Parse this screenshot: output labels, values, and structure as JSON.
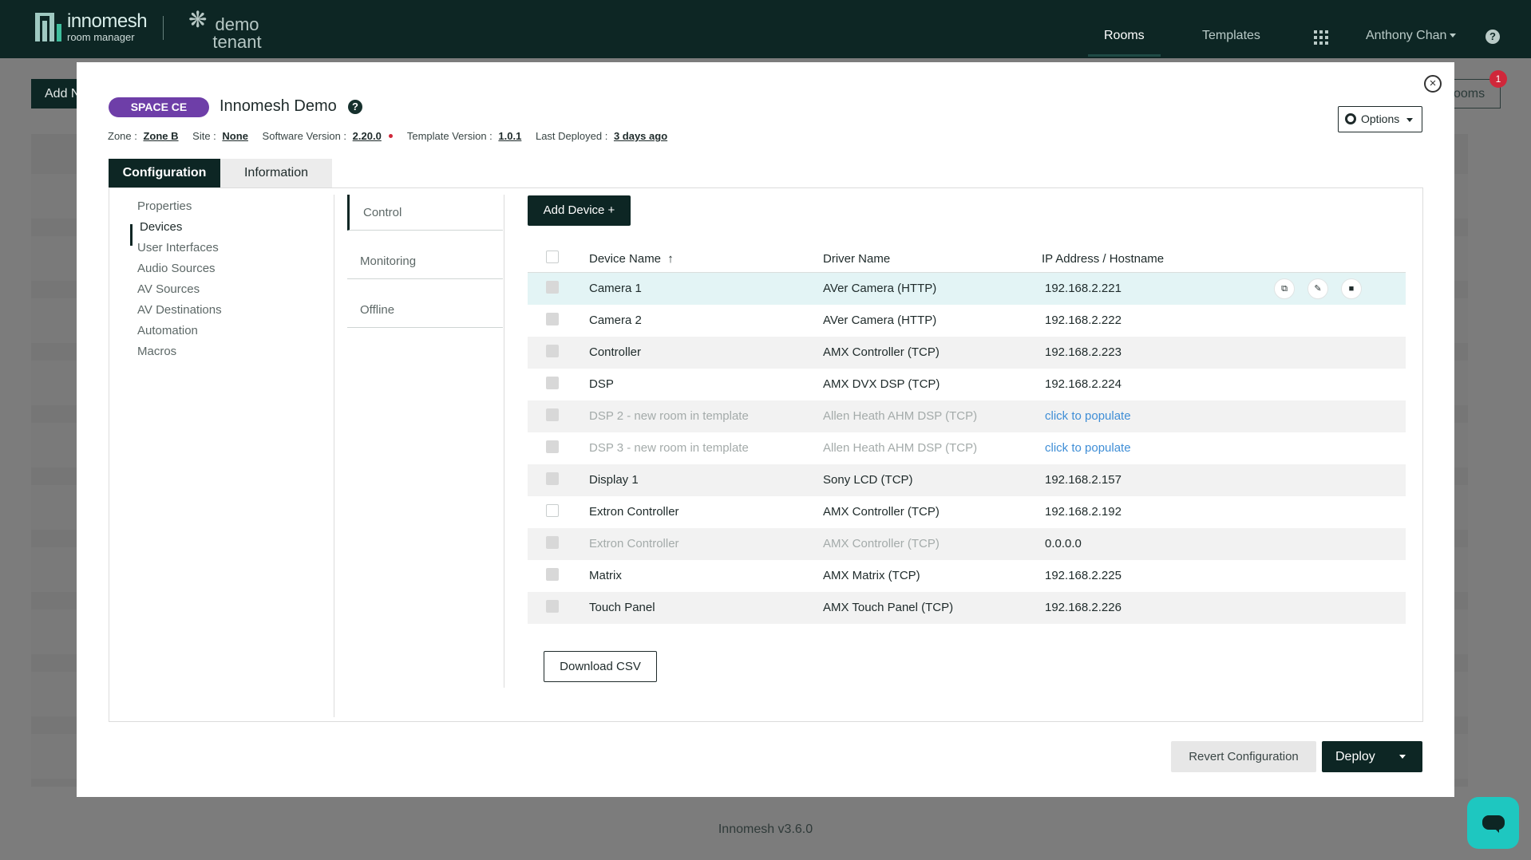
{
  "nav": {
    "brand": "innomesh",
    "brand_sub": "room manager",
    "tenant": "demo tenant",
    "links": {
      "rooms": "Rooms",
      "templates": "Templates"
    },
    "user": "Anthony Chan",
    "help": "?"
  },
  "background": {
    "add_button": "Add N",
    "rooms_button": "ooms",
    "notification_count": "1",
    "footer": "Innomesh v3.6.0"
  },
  "modal": {
    "close": "×",
    "badge": "SPACE CE",
    "title": "Innomesh Demo",
    "title_help": "?",
    "meta": {
      "zone_label": "Zone :",
      "zone": "Zone B",
      "site_label": "Site :",
      "site": "None",
      "software_label": "Software Version :",
      "software": "2.20.0",
      "template_label": "Template Version :",
      "template": "1.0.1",
      "deployed_label": "Last Deployed :",
      "deployed": "3 days ago"
    },
    "options": "Options",
    "tabs": {
      "configuration": "Configuration",
      "information": "Information"
    },
    "sidebar": [
      "Properties",
      "Devices",
      "User Interfaces",
      "Audio Sources",
      "AV Sources",
      "AV Destinations",
      "Automation",
      "Macros"
    ],
    "subnav": [
      "Control",
      "Monitoring",
      "Offline"
    ],
    "add_device": "Add Device +",
    "table": {
      "headers": {
        "name": "Device Name",
        "driver": "Driver Name",
        "ip": "IP Address / Hostname"
      },
      "sort_icon": "↑",
      "rows": [
        {
          "name": "Camera 1",
          "driver": "AVer Camera (HTTP)",
          "ip": "192.168.2.221"
        },
        {
          "name": "Camera 2",
          "driver": "AVer Camera (HTTP)",
          "ip": "192.168.2.222"
        },
        {
          "name": "Controller",
          "driver": "AMX Controller (TCP)",
          "ip": "192.168.2.223"
        },
        {
          "name": "DSP",
          "driver": "AMX DVX DSP (TCP)",
          "ip": "192.168.2.224"
        },
        {
          "name": "DSP 2 - new room in template",
          "driver": "Allen Heath AHM DSP (TCP)",
          "ip": "click to populate"
        },
        {
          "name": "DSP 3 - new room in template",
          "driver": "Allen Heath AHM DSP (TCP)",
          "ip": "click to populate"
        },
        {
          "name": "Display 1",
          "driver": "Sony LCD (TCP)",
          "ip": "192.168.2.157"
        },
        {
          "name": "Extron Controller",
          "driver": "AMX Controller (TCP)",
          "ip": "192.168.2.192"
        },
        {
          "name": "Extron Controller",
          "driver": "AMX Controller (TCP)",
          "ip": "0.0.0.0"
        },
        {
          "name": "Matrix",
          "driver": "AMX Matrix (TCP)",
          "ip": "192.168.2.225"
        },
        {
          "name": "Touch Panel",
          "driver": "AMX Touch Panel (TCP)",
          "ip": "192.168.2.226"
        }
      ]
    },
    "download_csv": "Download CSV",
    "revert": "Revert Configuration",
    "deploy": "Deploy"
  },
  "colors": {
    "brand_dark": "#0d2624",
    "accent_teal": "#3fbf9d",
    "badge_purple": "#6e3ea8",
    "link_blue": "#3f8ed6",
    "notification_red": "#d0273a",
    "chat_teal": "#1ec7c0"
  },
  "icons": [
    "logo-icon",
    "apps-grid-icon",
    "help-icon",
    "close-icon",
    "gear-icon",
    "sort-ascending-icon",
    "copy-icon",
    "edit-icon",
    "delete-icon",
    "chat-icon",
    "caret-down-icon"
  ]
}
